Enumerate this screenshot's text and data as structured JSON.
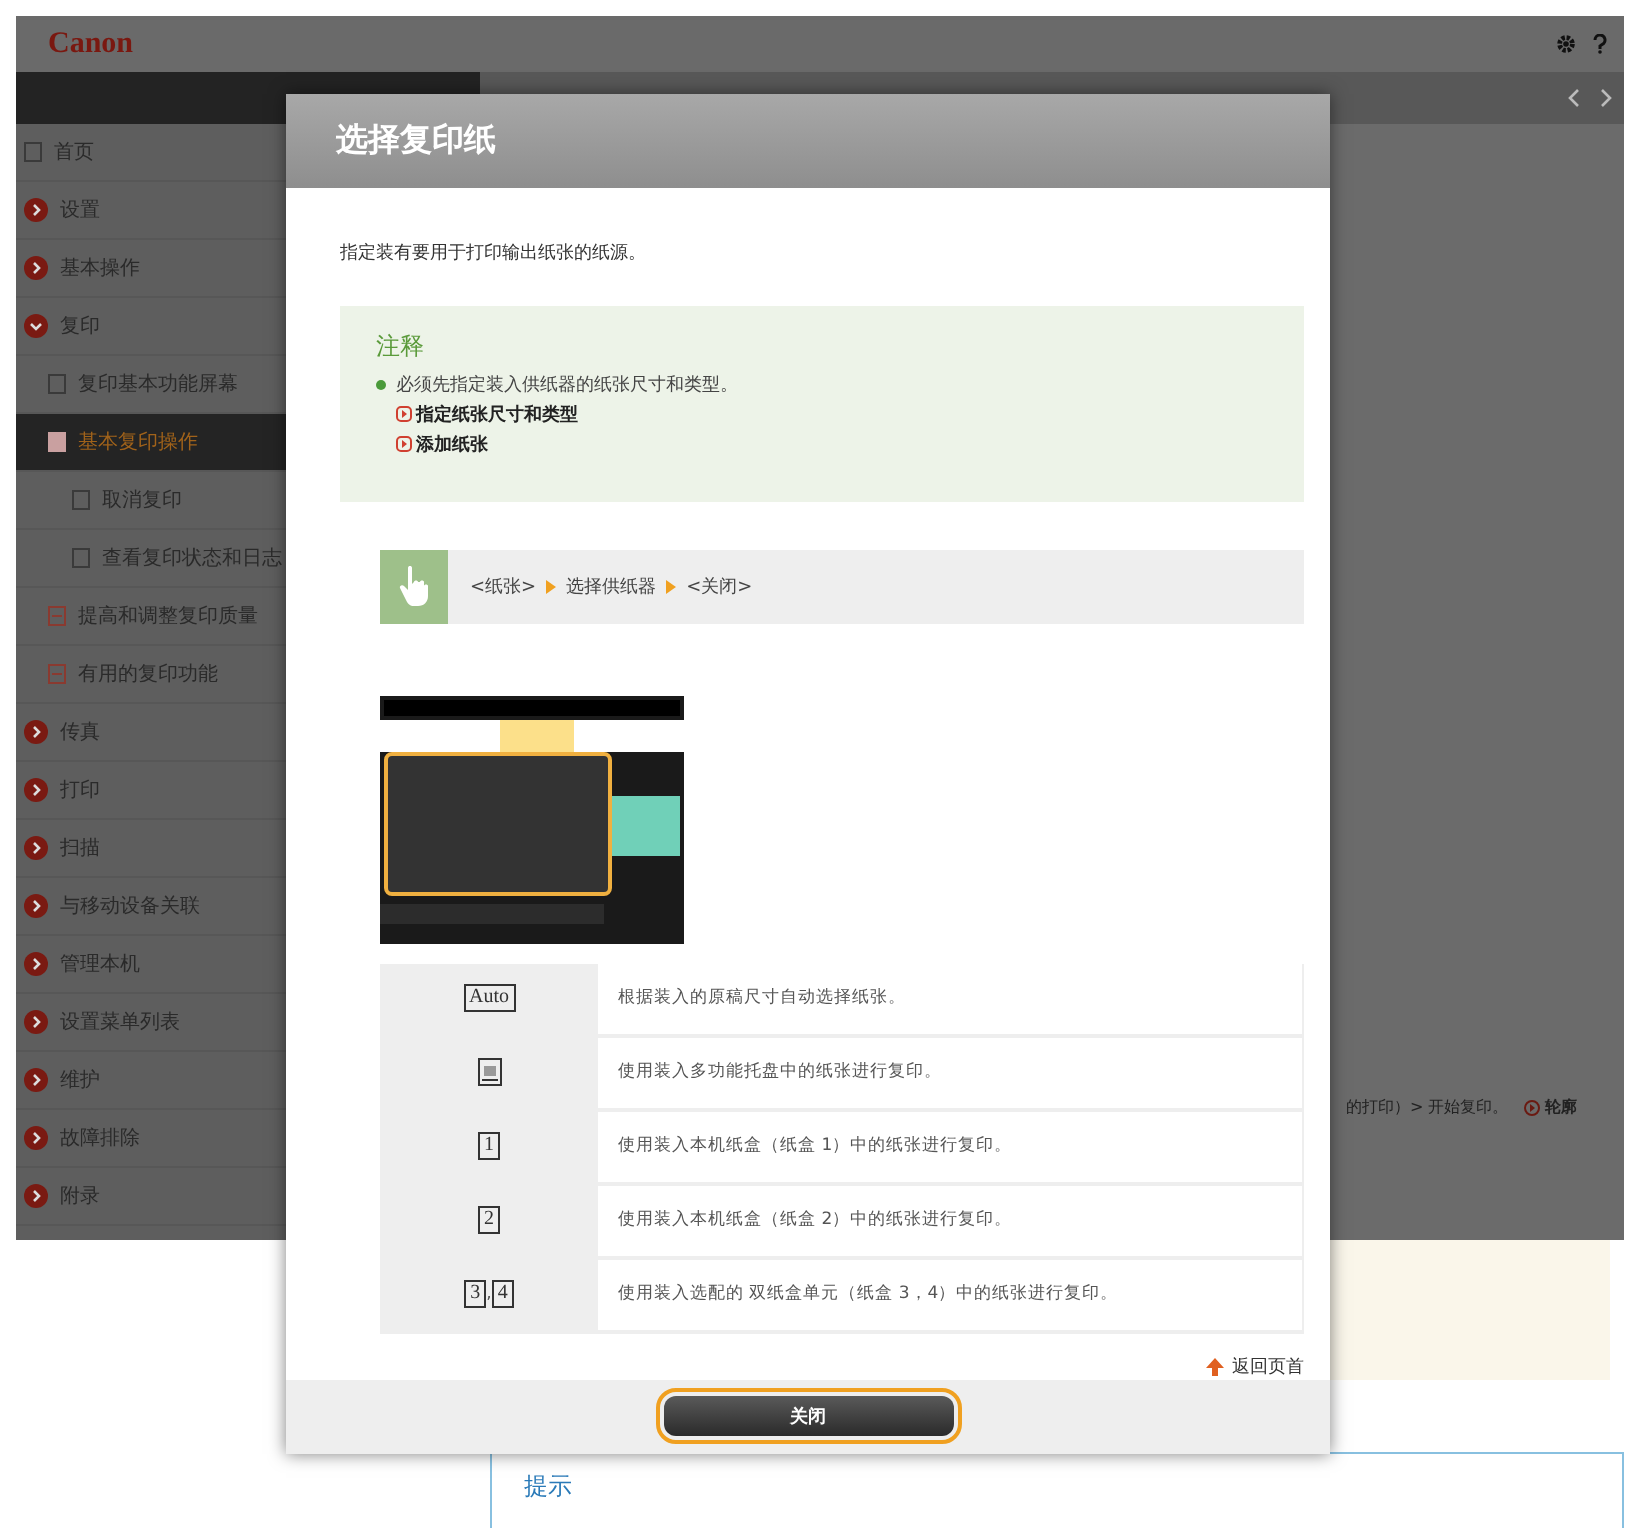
{
  "header": {
    "logo": "Canon"
  },
  "sidebar": {
    "items": [
      {
        "label": "首页",
        "kind": "page",
        "selected": false
      },
      {
        "label": "设置",
        "kind": "section",
        "expanded": false,
        "selected": false
      },
      {
        "label": "基本操作",
        "kind": "section",
        "expanded": false,
        "selected": false
      },
      {
        "label": "复印",
        "kind": "section",
        "expanded": true,
        "selected": false,
        "children": [
          {
            "label": "复印基本功能屏幕",
            "kind": "page",
            "selected": false
          },
          {
            "label": "基本复印操作",
            "kind": "page",
            "selected": true,
            "children": [
              {
                "label": "取消复印",
                "kind": "page",
                "selected": false
              },
              {
                "label": "查看复印状态和日志",
                "kind": "page",
                "selected": false
              }
            ]
          },
          {
            "label": "提高和调整复印质量",
            "kind": "folder",
            "selected": false
          },
          {
            "label": "有用的复印功能",
            "kind": "folder",
            "selected": false
          }
        ]
      },
      {
        "label": "传真",
        "kind": "section",
        "expanded": false,
        "selected": false
      },
      {
        "label": "打印",
        "kind": "section",
        "expanded": false,
        "selected": false
      },
      {
        "label": "扫描",
        "kind": "section",
        "expanded": false,
        "selected": false
      },
      {
        "label": "与移动设备关联",
        "kind": "section",
        "expanded": false,
        "selected": false
      },
      {
        "label": "管理本机",
        "kind": "section",
        "expanded": false,
        "selected": false
      },
      {
        "label": "设置菜单列表",
        "kind": "section",
        "expanded": false,
        "selected": false
      },
      {
        "label": "维护",
        "kind": "section",
        "expanded": false,
        "selected": false
      },
      {
        "label": "故障排除",
        "kind": "section",
        "expanded": false,
        "selected": false
      },
      {
        "label": "附录",
        "kind": "section",
        "expanded": false,
        "selected": false
      }
    ]
  },
  "content": {
    "fragment": "的打印）> 开始复印。",
    "link": "轮廓",
    "hint_title": "提示"
  },
  "dialog": {
    "title": "选择复印纸",
    "intro": "指定装有要用于打印输出纸张的纸源。",
    "note": {
      "title": "注释",
      "bullet": "必须先指定装入供纸器的纸张尺寸和类型。",
      "links": [
        "指定纸张尺寸和类型",
        "添加纸张"
      ]
    },
    "steps": [
      {
        "kind": "text",
        "text": "<纸张>"
      },
      {
        "kind": "arrow"
      },
      {
        "kind": "text",
        "text": "选择供纸器"
      },
      {
        "kind": "arrow"
      },
      {
        "kind": "text",
        "text": "<关闭>"
      }
    ],
    "table": {
      "rows": [
        {
          "keys": [
            {
              "kind": "text",
              "text": "Auto"
            }
          ],
          "description": "根据装入的原稿尺寸自动选择纸张。"
        },
        {
          "keys": [
            {
              "kind": "tray"
            }
          ],
          "description": "使用装入多功能托盘中的纸张进行复印。"
        },
        {
          "keys": [
            {
              "kind": "text",
              "text": "1"
            }
          ],
          "description": "使用装入本机纸盒（纸盒 1）中的纸张进行复印。"
        },
        {
          "keys": [
            {
              "kind": "text",
              "text": "2"
            }
          ],
          "description": "使用装入本机纸盒（纸盒 2）中的纸张进行复印。"
        },
        {
          "keys": [
            {
              "kind": "text",
              "text": "3"
            },
            {
              "kind": "separator",
              "text": ","
            },
            {
              "kind": "text",
              "text": "4"
            }
          ],
          "description": "使用装入选配的 双纸盒单元（纸盒 3，4）中的纸张进行复印。"
        }
      ]
    },
    "back_to_top": "返回页首",
    "close_button": "关闭"
  }
}
